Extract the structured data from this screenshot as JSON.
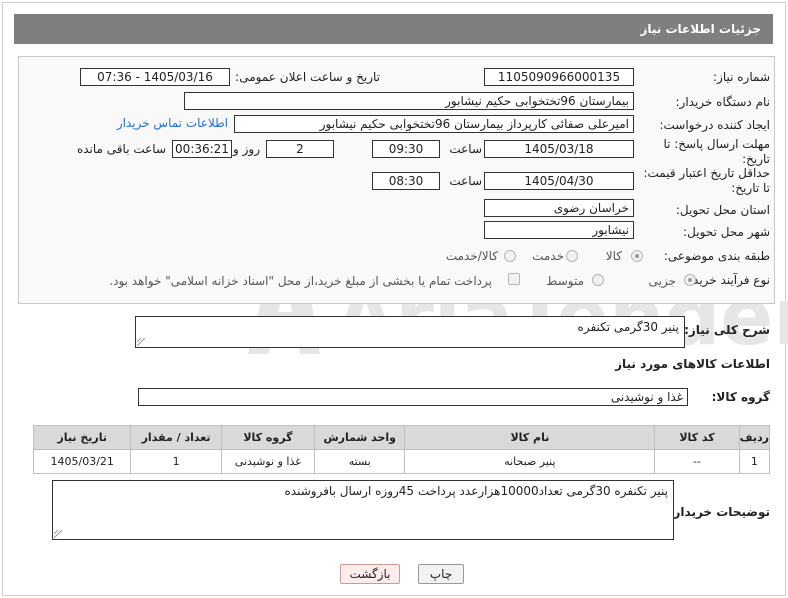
{
  "header": {
    "title": "جزئیات اطلاعات نیاز"
  },
  "fields": {
    "need_number_label": "شماره نیاز:",
    "need_number": "1105090966000135",
    "announce_label": "تاریخ و ساعت اعلان عمومی:",
    "announce_value": "1405/03/16 - 07:36",
    "buyer_org_label": "نام دستگاه خریدار:",
    "buyer_org": "بیمارستان 96تختخوابی حکیم نیشابور",
    "creator_label": "ایجاد کننده درخواست:",
    "creator": "امیرعلی صفائی کارپرداز بیمارستان 96تختخوابی حکیم نیشابور",
    "buyer_contact_link": "اطلاعات تماس خریدار",
    "deadline_label": "مهلت ارسال پاسخ: تا تاریخ:",
    "deadline_date": "1405/03/18",
    "time_label": "ساعت",
    "deadline_time": "09:30",
    "days_value": "2",
    "days_label": "روز و",
    "remaining_time": "00:36:21",
    "remaining_label": "ساعت باقی مانده",
    "min_price_label": "حداقل تاریخ اعتبار قیمت: تا تاریخ:",
    "min_price_date": "1405/04/30",
    "min_price_time": "08:30",
    "province_label": "استان محل تحویل:",
    "province": "خراسان رضوی",
    "city_label": "شهر محل تحویل:",
    "city": "نیشابور",
    "category_label": "طبقه بندی موضوعی:",
    "category_options": [
      "کالا",
      "خدمت",
      "کالا/خدمت"
    ],
    "process_label": "نوع فرآیند خرید :",
    "process_options": [
      "جزیی",
      "متوسط"
    ],
    "payment_note": "پرداخت تمام یا بخشی از مبلغ خرید،از محل \"اسناد خزانه اسلامی\" خواهد بود."
  },
  "description": {
    "label": "شرح کلی نیاز:",
    "value": "پنیر 30گرمی تکنفره"
  },
  "goods": {
    "section_title": "اطلاعات کالاهای مورد نیاز",
    "group_label": "گروه کالا:",
    "group_value": "غذا و نوشیدنی"
  },
  "table": {
    "headers": [
      "ردیف",
      "کد کالا",
      "نام کالا",
      "واحد شمارش",
      "گروه کالا",
      "تعداد / مقدار",
      "تاریخ نیاز"
    ],
    "rows": [
      [
        "1",
        "--",
        "پنیر صبحانه",
        "بسته",
        "غذا و نوشیدنی",
        "1",
        "1405/03/21"
      ]
    ]
  },
  "buyer_notes": {
    "label": "توضیحات خریدار:",
    "value": "پنیر تکنفره 30گرمی تعداد10000هزارعدد پرداخت 45روزه ارسال بافروشنده"
  },
  "buttons": {
    "print": "چاپ",
    "back": "بازگشت"
  },
  "watermark": {
    "text": "AriaTender.neT"
  }
}
